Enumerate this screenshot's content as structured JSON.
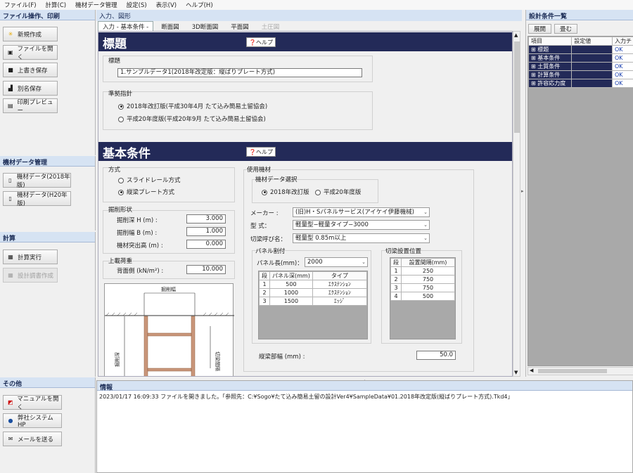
{
  "menu": [
    "ファイル(F)",
    "計算(C)",
    "機材データ管理",
    "設定(S)",
    "表示(V)",
    "ヘルプ(H)"
  ],
  "left": {
    "file_header": "ファイル操作、印刷",
    "file_buttons": [
      "新規作成",
      "ファイルを開く",
      "上書き保存",
      "別名保存",
      "印刷プレビュー"
    ],
    "material_header": "機材データ管理",
    "material_buttons": [
      "機材データ(2018年版)",
      "機材データ(H20年版)"
    ],
    "calc_header": "計算",
    "calc_buttons": [
      "計算実行",
      "設計調書作成"
    ],
    "other_header": "その他",
    "other_buttons": [
      "マニュアルを開く",
      "弊社システムHP",
      "メールを送る"
    ]
  },
  "center": {
    "header": "入力、図形",
    "tabs": [
      "入力 - 基本条件 -",
      "断面図",
      "3D断面図",
      "平面図",
      "土圧図"
    ],
    "help_label": "ヘルプ",
    "title_section": {
      "banner": "標題",
      "title_label": "標題",
      "title_value": "1.サンプルデータ1(2018年改定版：縦ばりプレート方式)",
      "standard_label": "準拠指針",
      "standard_options": [
        "2018年改訂版(平成30年4月  たて込み簡易土留協会)",
        "平成20年度版(平成20年9月  たて込み簡易土留協会)"
      ]
    },
    "basic": {
      "banner": "基本条件",
      "method_label": "方式",
      "method_options": [
        "スライドレール方式",
        "縦梁プレート方式"
      ],
      "excavation_label": "掘削形状",
      "exc_depth_label": "掘削深    H  (m)   :",
      "exc_depth_value": "3.000",
      "exc_width_label": "掘削幅    B  (m)   :",
      "exc_width_value": "1.000",
      "material_protrude_label": "機材突出高   (m)   :",
      "material_protrude_value": "0.000",
      "surcharge_label": "上載荷重",
      "back_label": "背面側   (kN/m²)   :",
      "back_value": "10.000",
      "diagram_top_label": "掘削幅",
      "diagram_left_label": "掘削深",
      "diagram_right_label": "切梁間隔",
      "used_material_label": "使用機材",
      "material_select_label": "機材データ選択",
      "material_options": [
        "2018年改訂版",
        "平成20年度版"
      ],
      "maker_label": "メーカー   :",
      "maker_value": "(旧)H・Sパネルサービス(アイケイ伊藤機械)",
      "type_label": "型      式：",
      "type_value": "軽量型−軽量タイプ−3000",
      "strut_label": "切梁呼び名：",
      "strut_value": "軽量型  0.85m以上",
      "panel_label": "パネル割付",
      "panel_len_label": "パネル長(mm)：",
      "panel_len_value": "2000",
      "panel_cols": [
        "段",
        "パネル深(mm)",
        "タイプ"
      ],
      "panel_rows": [
        [
          "1",
          "500",
          "ｴｸｽﾃﾝｼｮﾝ"
        ],
        [
          "2",
          "1000",
          "ｴｸｽﾃﾝｼｮﾝ"
        ],
        [
          "3",
          "1500",
          "ｴｯｼﾞ"
        ]
      ],
      "strut_pos_label": "切梁設置位置",
      "strut_cols": [
        "段",
        "設置間隔(mm)"
      ],
      "strut_rows": [
        [
          "1",
          "250"
        ],
        [
          "2",
          "750"
        ],
        [
          "3",
          "750"
        ],
        [
          "4",
          "500"
        ]
      ],
      "beam_width_label": "縦梁部幅  (mm)   :",
      "beam_width_value": "50.0"
    }
  },
  "right": {
    "header": "設計条件一覧",
    "expand": "展開",
    "collapse": "畳む",
    "cols": [
      "項目",
      "設定値",
      "入力チ"
    ],
    "rows": [
      [
        "標題",
        "",
        "OK"
      ],
      [
        "基本条件",
        "",
        "OK"
      ],
      [
        "土質条件",
        "",
        "OK"
      ],
      [
        "計算条件",
        "",
        "OK"
      ],
      [
        "許容応力度",
        "",
        "OK"
      ]
    ]
  },
  "info": {
    "header": "情報",
    "message": "2023/01/17 16:09:33 ファイルを開きました。「参照先：C:¥Sogo¥たて込み簡易土留の設計Ver4¥SampleData¥01.2018年改定版(縦ばりプレート方式).Tkd4」"
  }
}
